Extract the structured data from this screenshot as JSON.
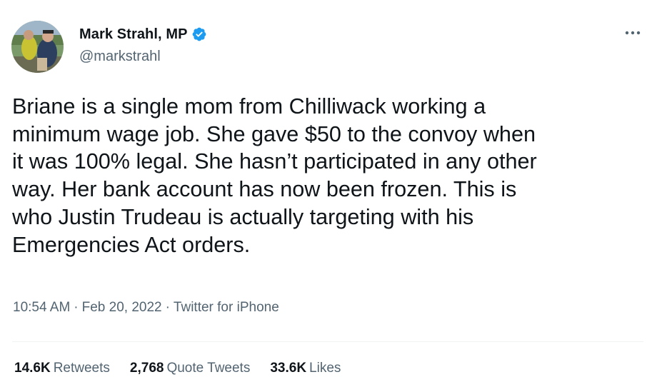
{
  "colors": {
    "text": "#0f1419",
    "secondary": "#536471",
    "verified": "#1d9bf0",
    "divider": "#eff3f4"
  },
  "author": {
    "display_name": "Mark Strahl, MP",
    "handle": "@markstrahl",
    "verified_icon": "verified-badge-icon"
  },
  "tweet": {
    "text": "Briane is a single mom from Chilliwack working a\nminimum wage job. She gave $50 to the convoy when\nit was 100% legal. She hasn’t participated in any other\nway. Her bank account has now been frozen. This is\nwho Justin Trudeau is actually targeting with his\nEmergencies Act orders."
  },
  "meta": {
    "time": "10:54 AM",
    "separator": "·",
    "date": "Feb 20, 2022",
    "source": "Twitter for iPhone"
  },
  "stats": {
    "retweets_count": "14.6K",
    "retweets_label": "Retweets",
    "quotes_count": "2,768",
    "quotes_label": "Quote Tweets",
    "likes_count": "33.6K",
    "likes_label": "Likes"
  }
}
